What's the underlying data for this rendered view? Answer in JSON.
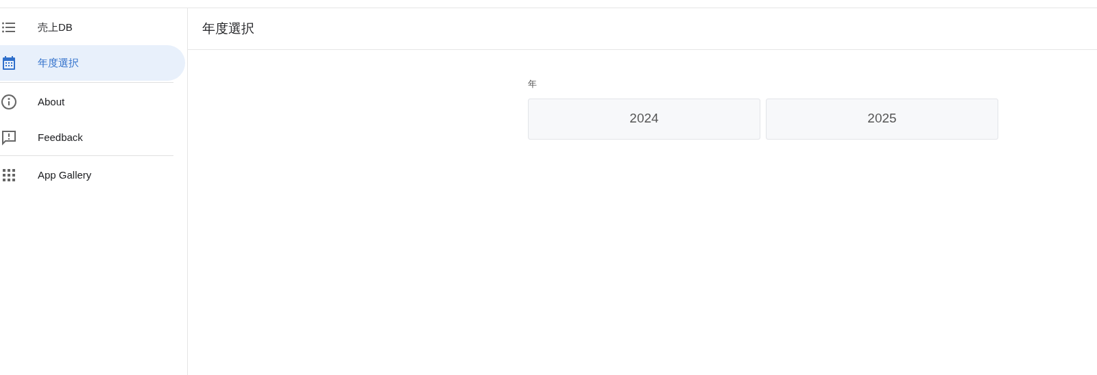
{
  "sidebar": {
    "groups": [
      {
        "items": [
          {
            "label": "売上DB",
            "kind": "list",
            "selected": false
          },
          {
            "label": "年度選択",
            "kind": "calendar",
            "selected": true
          }
        ]
      },
      {
        "items": [
          {
            "label": "About",
            "kind": "info",
            "selected": false
          },
          {
            "label": "Feedback",
            "kind": "feedback",
            "selected": false
          }
        ]
      },
      {
        "items": [
          {
            "label": "App Gallery",
            "kind": "apps",
            "selected": false
          }
        ]
      }
    ]
  },
  "header": {
    "title": "年度選択"
  },
  "year_field": {
    "label": "年",
    "options": [
      "2024",
      "2025"
    ]
  }
}
